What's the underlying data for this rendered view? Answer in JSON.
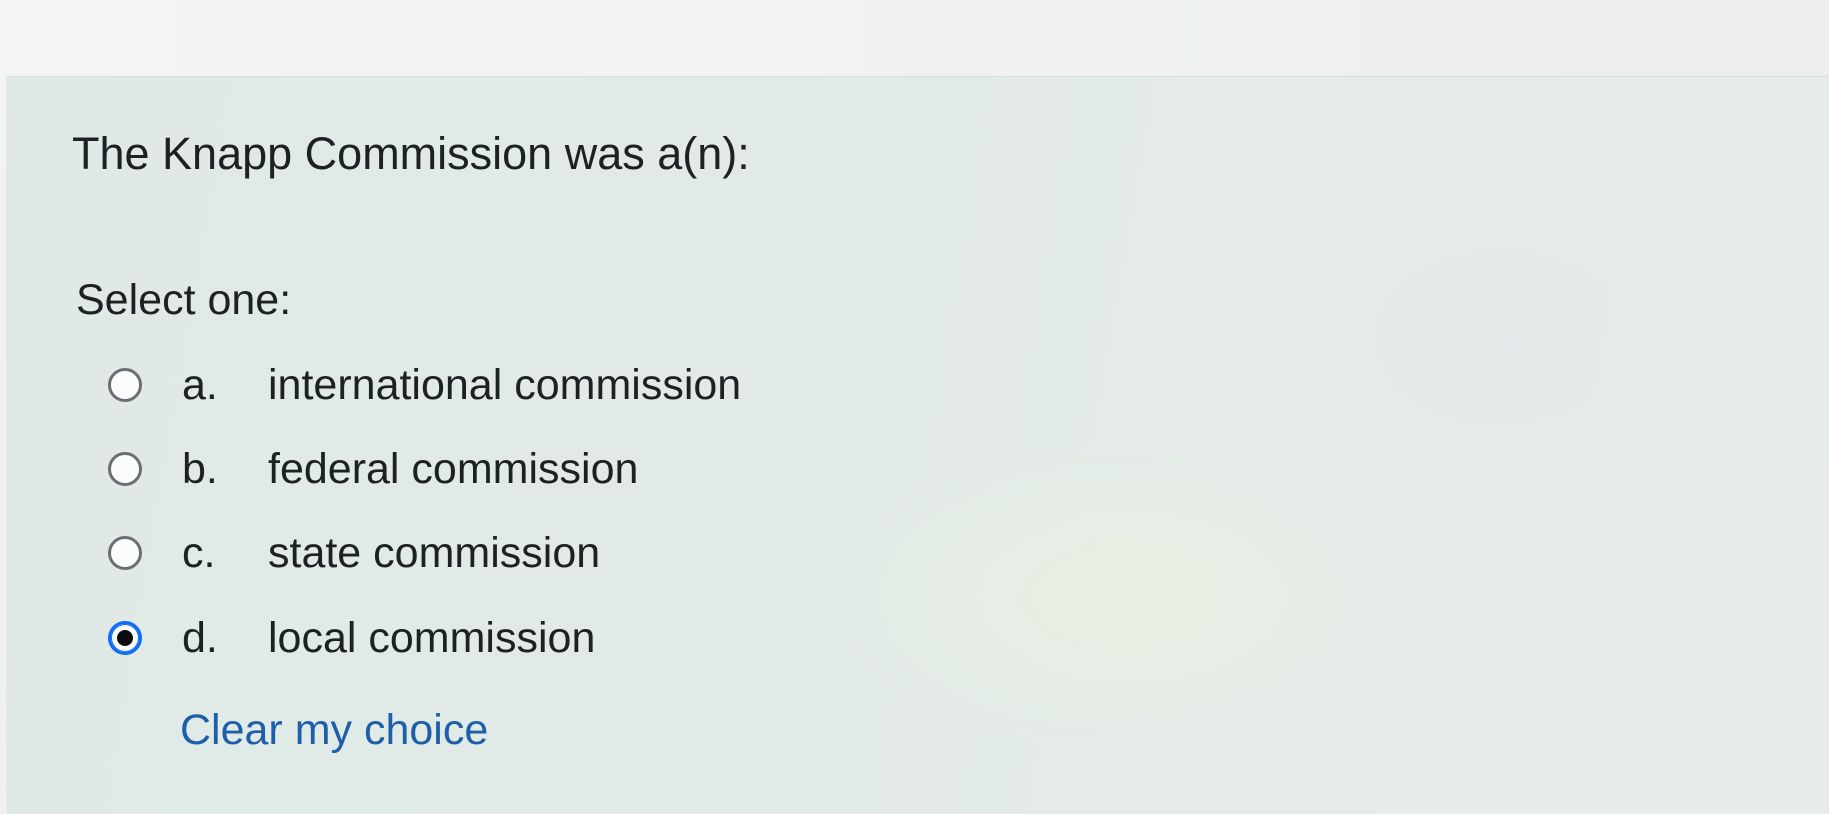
{
  "question": {
    "text": "The Knapp Commission was a(n):",
    "prompt": "Select one:",
    "options": [
      {
        "letter": "a.",
        "label": "international commission",
        "selected": false
      },
      {
        "letter": "b.",
        "label": "federal commission",
        "selected": false
      },
      {
        "letter": "c.",
        "label": "state commission",
        "selected": false
      },
      {
        "letter": "d.",
        "label": "local commission",
        "selected": true
      }
    ],
    "clear_label": "Clear my choice"
  },
  "colors": {
    "accent": "#0f6cf3",
    "link": "#1d5fa8",
    "text": "#1d2124"
  }
}
